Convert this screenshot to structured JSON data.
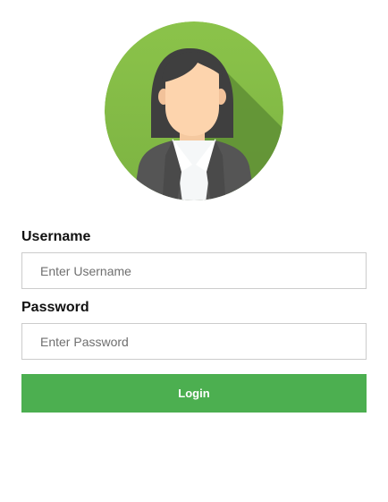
{
  "avatar": {
    "icon": "woman-avatar-icon",
    "background_color": "#8bc34a"
  },
  "form": {
    "username": {
      "label": "Username",
      "placeholder": "Enter Username",
      "value": ""
    },
    "password": {
      "label": "Password",
      "placeholder": "Enter Password",
      "value": ""
    },
    "login_label": "Login"
  },
  "colors": {
    "button": "#4caf50",
    "button_text": "#ffffff"
  }
}
